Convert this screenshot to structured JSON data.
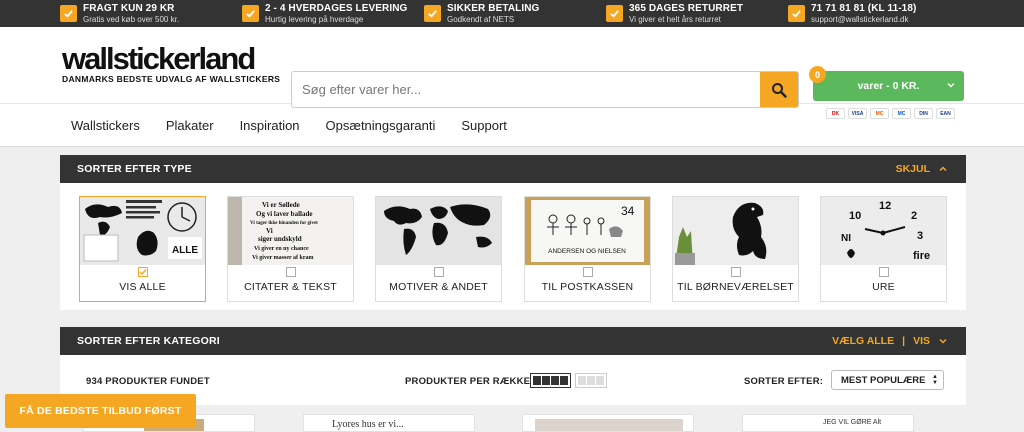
{
  "topbar": [
    {
      "title": "FRAGT KUN 29 KR",
      "sub": "Gratis ved køb over 500 kr."
    },
    {
      "title": "2 - 4 HVERDAGES LEVERING",
      "sub": "Hurtig levering på hverdage"
    },
    {
      "title": "SIKKER BETALING",
      "sub": "Godkendt af NETS"
    },
    {
      "title": "365 DAGES RETURRET",
      "sub": "Vi giver et helt års returret"
    },
    {
      "title": "71 71 81 81 (KL 11-18)",
      "sub": "support@wallstickerland.dk"
    }
  ],
  "logo": {
    "main": "wallstickerland",
    "sub": "DANMARKS BEDSTE UDVALG AF WALLSTICKERS"
  },
  "search": {
    "placeholder": "Søg efter varer her..."
  },
  "cart": {
    "count": "0",
    "label": "varer - 0 KR."
  },
  "payments": [
    "DK",
    "VISA",
    "MC",
    "MC",
    "DIN",
    "EAN"
  ],
  "nav": [
    "Wallstickers",
    "Plakater",
    "Inspiration",
    "Opsætningsgaranti",
    "Support"
  ],
  "type_panel": {
    "title": "SORTER EFTER TYPE",
    "action": "SKJUL",
    "tiles": [
      {
        "label": "VIS ALLE",
        "active": true,
        "img_text": "ALLE"
      },
      {
        "label": "CITATER & TEKST",
        "active": false,
        "img_text": "Vi er Søllede\nOg vi laver ballade\nVi tager ikke hinanden for givet\nVi siger undskyld\nVi giver en ny chance\nVi giver masser af kram"
      },
      {
        "label": "MOTIVER & ANDET",
        "active": false,
        "img_text": ""
      },
      {
        "label": "TIL POSTKASSEN",
        "active": false,
        "img_text": "ANDERSEN OG NIELSEN",
        "img_number": "34"
      },
      {
        "label": "TIL BØRNEVÆRELSET",
        "active": false,
        "img_text": ""
      },
      {
        "label": "URE",
        "active": false,
        "img_text": "fire"
      }
    ]
  },
  "category_panel": {
    "title": "SORTER EFTER KATEGORI",
    "action_left": "VÆLG ALLE",
    "separator": "|",
    "action_right": "VIS"
  },
  "toolbar": {
    "found": "934 PRODUKTER FUNDET",
    "per_row": "PRODUKTER PER RÆKKE",
    "sort_label": "SORTER EFTER:",
    "sort_value": "MEST POPULÆRE"
  },
  "products": [
    {
      "text": ""
    },
    {
      "text": "Lyores hus er vi..."
    },
    {
      "text": ""
    },
    {
      "text": "JEG VIL GØRE Alt"
    }
  ],
  "offer_button": "FÅ DE BEDSTE TILBUD FØRST",
  "colors": {
    "accent": "#f5a623",
    "dark": "#333333",
    "cart": "#5cb85c"
  }
}
